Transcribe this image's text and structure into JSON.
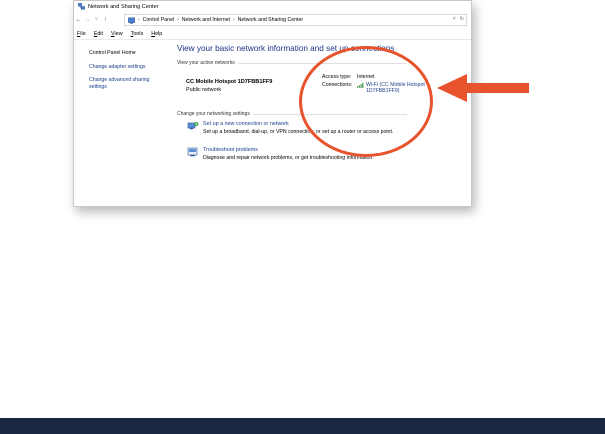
{
  "window": {
    "title": "Network and Sharing Center"
  },
  "address": {
    "segments": [
      "Control Panel",
      "Network and Internet",
      "Network and Sharing Center"
    ],
    "separator": "›"
  },
  "nav": {
    "back": "←",
    "forward": "→",
    "up": "↑",
    "down": "˅",
    "history": "˅",
    "refresh": "↻"
  },
  "menu": {
    "items": [
      {
        "key": "F",
        "rest": "ile"
      },
      {
        "key": "E",
        "rest": "dit"
      },
      {
        "key": "V",
        "rest": "iew"
      },
      {
        "key": "T",
        "rest": "ools"
      },
      {
        "key": "H",
        "rest": "elp"
      }
    ]
  },
  "sidebar": {
    "items": [
      {
        "label": "Control Panel Home"
      },
      {
        "label": "Change adapter settings"
      },
      {
        "label": "Change advanced sharing settings"
      }
    ]
  },
  "main": {
    "heading": "View your basic network information and set up connections",
    "active_label": "View your active networks",
    "network": {
      "name": "CC Mobile Hotspot 1D7FBB1FF9",
      "type": "Public network",
      "access_type_label": "Access type:",
      "access_type_value": "Internet",
      "connections_label": "Connections:",
      "connection_line1": "Wi-Fi (CC Mobile Hotspot",
      "connection_line2": "1D7FBB1FF9)"
    },
    "change_label": "Change your networking settings",
    "tasks": [
      {
        "link": "Set up a new connection or network",
        "desc": "Set up a broadband, dial-up, or VPN connection; or set up a router or access point."
      },
      {
        "link": "Troubleshoot problems",
        "desc": "Diagnose and repair network problems, or get troubleshooting information."
      }
    ]
  },
  "colors": {
    "annotation": "#e6532c",
    "link": "#1a3e8c",
    "heading": "#1e3287",
    "footer": "#1b2640"
  }
}
